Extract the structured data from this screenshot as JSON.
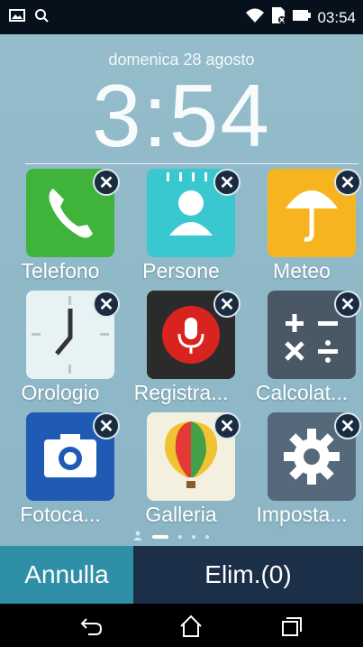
{
  "status_bar": {
    "time": "03:54",
    "icons": [
      "image-icon",
      "notification-icon",
      "wifi-icon",
      "sim-icon",
      "battery-icon"
    ]
  },
  "lockscreen": {
    "date": "domenica 28 agosto",
    "clock": "3:54"
  },
  "apps": [
    {
      "label": "Telefono",
      "icon": "phone-icon",
      "color": "#3fb33a"
    },
    {
      "label": "Persone",
      "icon": "contacts-icon",
      "color": "#39c7d0"
    },
    {
      "label": "Meteo",
      "icon": "umbrella-icon",
      "color": "#f6b51f"
    },
    {
      "label": "Orologio",
      "icon": "clock-icon",
      "color": "#e7f2f4"
    },
    {
      "label": "Registra...",
      "icon": "microphone-icon",
      "color": "#2b2b2b"
    },
    {
      "label": "Calcolat...",
      "icon": "calculator-icon",
      "color": "#4a5866"
    },
    {
      "label": "Fotoca...",
      "icon": "camera-icon",
      "color": "#1f5bb4"
    },
    {
      "label": "Galleria",
      "icon": "balloon-icon",
      "color": "#f3f0df"
    },
    {
      "label": "Imposta...",
      "icon": "gear-icon",
      "color": "#56697b"
    }
  ],
  "page_indicator": {
    "pages": 5,
    "active": 1
  },
  "actions": {
    "cancel_label": "Annulla",
    "delete_label": "Elim.(0)"
  },
  "nav": {
    "icons": [
      "back-icon",
      "home-icon",
      "recents-icon"
    ]
  }
}
